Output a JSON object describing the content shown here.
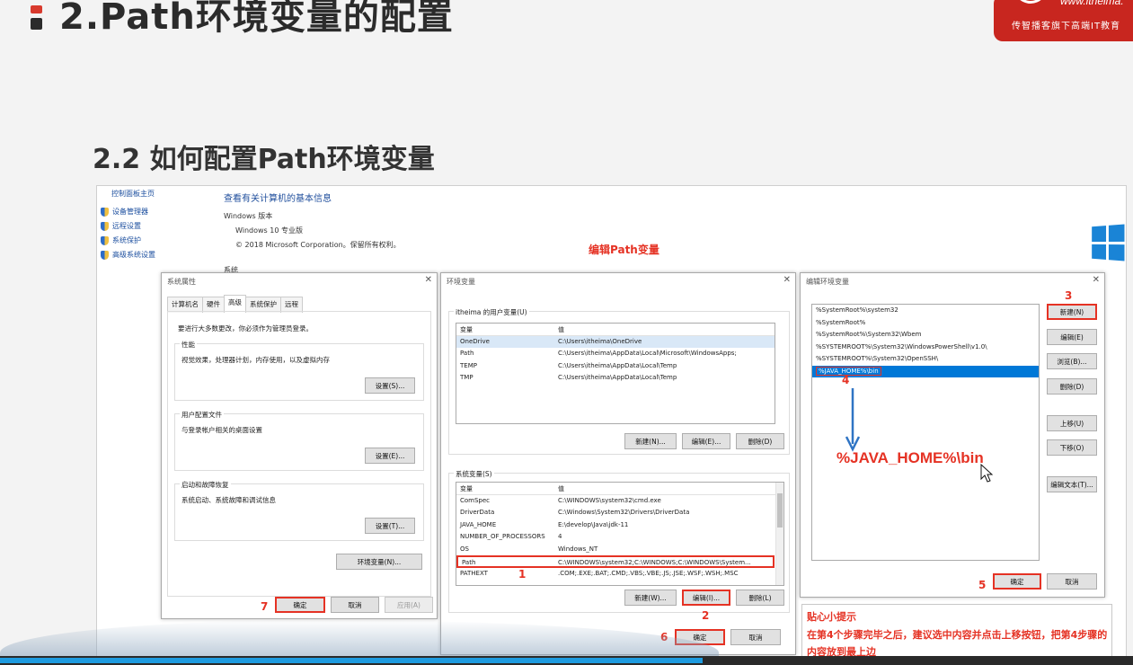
{
  "slide": {
    "title": "2.Path环境变量的配置",
    "subtitle": "2.2 如何配置Path环境变量",
    "brand_url": "www.itheima.",
    "brand_slogan": "传智播客旗下高端IT教育"
  },
  "control_panel": {
    "home": "控制面板主页",
    "links": [
      "设备管理器",
      "远程设置",
      "系统保护",
      "高级系统设置"
    ],
    "heading": "查看有关计算机的基本信息",
    "section_windows": "Windows 版本",
    "edition": "Windows 10 专业版",
    "copyright": "© 2018 Microsoft Corporation。保留所有权利。",
    "section_system": "系统"
  },
  "annotations": {
    "top_label": "编辑Path变量",
    "big_value": "%JAVA_HOME%\\bin",
    "steps": [
      "1",
      "2",
      "3",
      "4",
      "5",
      "6",
      "7"
    ]
  },
  "sys_props": {
    "title": "系统属性",
    "tabs": [
      "计算机名",
      "硬件",
      "高级",
      "系统保护",
      "远程"
    ],
    "intro": "要进行大多数更改，你必须作为管理员登录。",
    "perf_label": "性能",
    "perf_desc": "视觉效果，处理器计划，内存使用，以及虚拟内存",
    "perf_btn": "设置(S)...",
    "profile_label": "用户配置文件",
    "profile_desc": "与登录帐户相关的桌面设置",
    "profile_btn": "设置(E)...",
    "startup_label": "启动和故障恢复",
    "startup_desc": "系统启动、系统故障和调试信息",
    "startup_btn": "设置(T)...",
    "env_btn": "环境变量(N)...",
    "ok": "确定",
    "cancel": "取消",
    "apply": "应用(A)"
  },
  "env_vars": {
    "title": "环境变量",
    "user_group": "itheima 的用户变量(U)",
    "col_var": "变量",
    "col_val": "值",
    "user_rows": [
      {
        "name": "OneDrive",
        "value": "C:\\Users\\itheima\\OneDrive"
      },
      {
        "name": "Path",
        "value": "C:\\Users\\itheima\\AppData\\Local\\Microsoft\\WindowsApps;"
      },
      {
        "name": "TEMP",
        "value": "C:\\Users\\itheima\\AppData\\Local\\Temp"
      },
      {
        "name": "TMP",
        "value": "C:\\Users\\itheima\\AppData\\Local\\Temp"
      }
    ],
    "user_new": "新建(N)...",
    "user_edit": "编辑(E)...",
    "user_delete": "删除(D)",
    "sys_group": "系统变量(S)",
    "sys_rows": [
      {
        "name": "ComSpec",
        "value": "C:\\WINDOWS\\system32\\cmd.exe"
      },
      {
        "name": "DriverData",
        "value": "C:\\Windows\\System32\\Drivers\\DriverData"
      },
      {
        "name": "JAVA_HOME",
        "value": "E:\\develop\\Java\\jdk-11"
      },
      {
        "name": "NUMBER_OF_PROCESSORS",
        "value": "4"
      },
      {
        "name": "OS",
        "value": "Windows_NT"
      },
      {
        "name": "Path",
        "value": "C:\\WINDOWS\\system32;C:\\WINDOWS;C:\\WINDOWS\\System..."
      },
      {
        "name": "PATHEXT",
        "value": ".COM;.EXE;.BAT;.CMD;.VBS;.VBE;.JS;.JSE;.WSF;.WSH;.MSC"
      }
    ],
    "sys_new": "新建(W)...",
    "sys_edit": "编辑(I)...",
    "sys_delete": "删除(L)",
    "ok": "确定",
    "cancel": "取消"
  },
  "edit_env": {
    "title": "编辑环境变量",
    "items": [
      "%SystemRoot%\\system32",
      "%SystemRoot%",
      "%SystemRoot%\\System32\\Wbem",
      "%SYSTEMROOT%\\System32\\WindowsPowerShell\\v1.0\\",
      "%SYSTEMROOT%\\System32\\OpenSSH\\",
      "%JAVA_HOME%\\bin"
    ],
    "btn_new": "新建(N)",
    "btn_edit": "编辑(E)",
    "btn_browse": "浏览(B)...",
    "btn_delete": "删除(D)",
    "btn_up": "上移(U)",
    "btn_down": "下移(O)",
    "btn_edit_text": "编辑文本(T)...",
    "ok": "确定",
    "cancel": "取消"
  },
  "tip": {
    "title": "贴心小提示",
    "text": "在第4个步骤完毕之后，建议选中内容并点击上移按钮，把第4步骤的内容放到最上边"
  },
  "video": {
    "progress": 0.62
  },
  "colors": {
    "accent_red": "#e53224",
    "select_blue": "#0078d7",
    "brand_red": "#c8261f"
  }
}
